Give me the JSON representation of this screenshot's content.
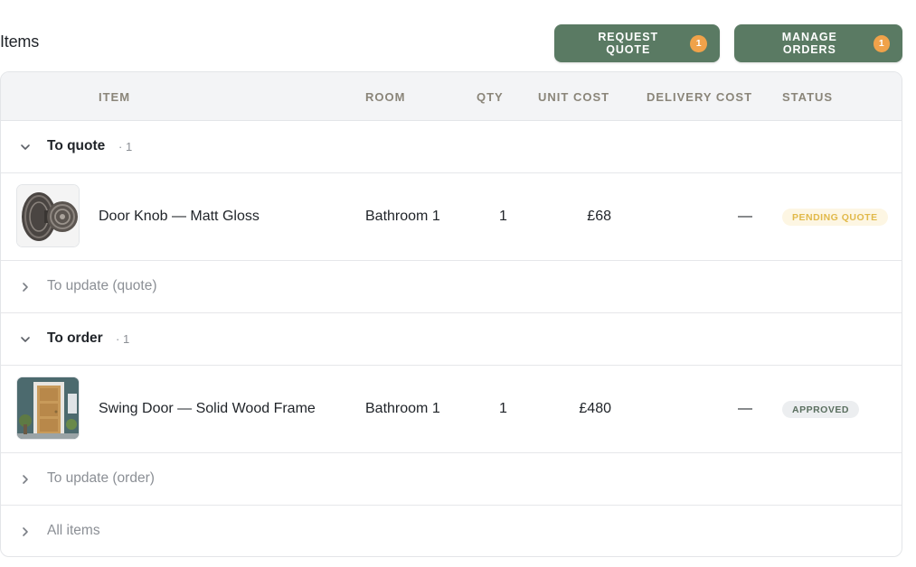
{
  "page": {
    "title": "Items"
  },
  "actions": {
    "request_quote": {
      "label": "REQUEST QUOTE",
      "count": "1"
    },
    "manage_orders": {
      "label": "MANAGE ORDERS",
      "count": "1"
    }
  },
  "table": {
    "columns": [
      "ITEM",
      "ROOM",
      "QTY",
      "UNIT COST",
      "DELIVERY COST",
      "STATUS"
    ],
    "groups": [
      {
        "title": "To quote",
        "count": "· 1",
        "expanded": true,
        "items": [
          {
            "name": "Door Knob — Matt Gloss",
            "room": "Bathroom 1",
            "qty": "1",
            "unit_cost": "£68",
            "delivery_cost": "—",
            "status": "PENDING QUOTE",
            "thumb_icon": "door-knob-image"
          }
        ]
      },
      {
        "title": "To update (quote)",
        "expanded": false
      },
      {
        "title": "To order",
        "count": "· 1",
        "expanded": true,
        "items": [
          {
            "name": "Swing Door — Solid Wood Frame",
            "room": "Bathroom 1",
            "qty": "1",
            "unit_cost": "£480",
            "delivery_cost": "—",
            "status": "APPROVED",
            "thumb_icon": "wooden-door-image"
          }
        ]
      },
      {
        "title": "To update (order)",
        "expanded": false
      },
      {
        "title": "All items",
        "expanded": false
      }
    ]
  },
  "colors": {
    "primary_button": "#5a7a63",
    "badge": "#f0a24a",
    "pending_bg": "#fdf6e3",
    "pending_text": "#e1b94a",
    "approved_bg": "#eceef0",
    "approved_text": "#5a6f5f"
  }
}
